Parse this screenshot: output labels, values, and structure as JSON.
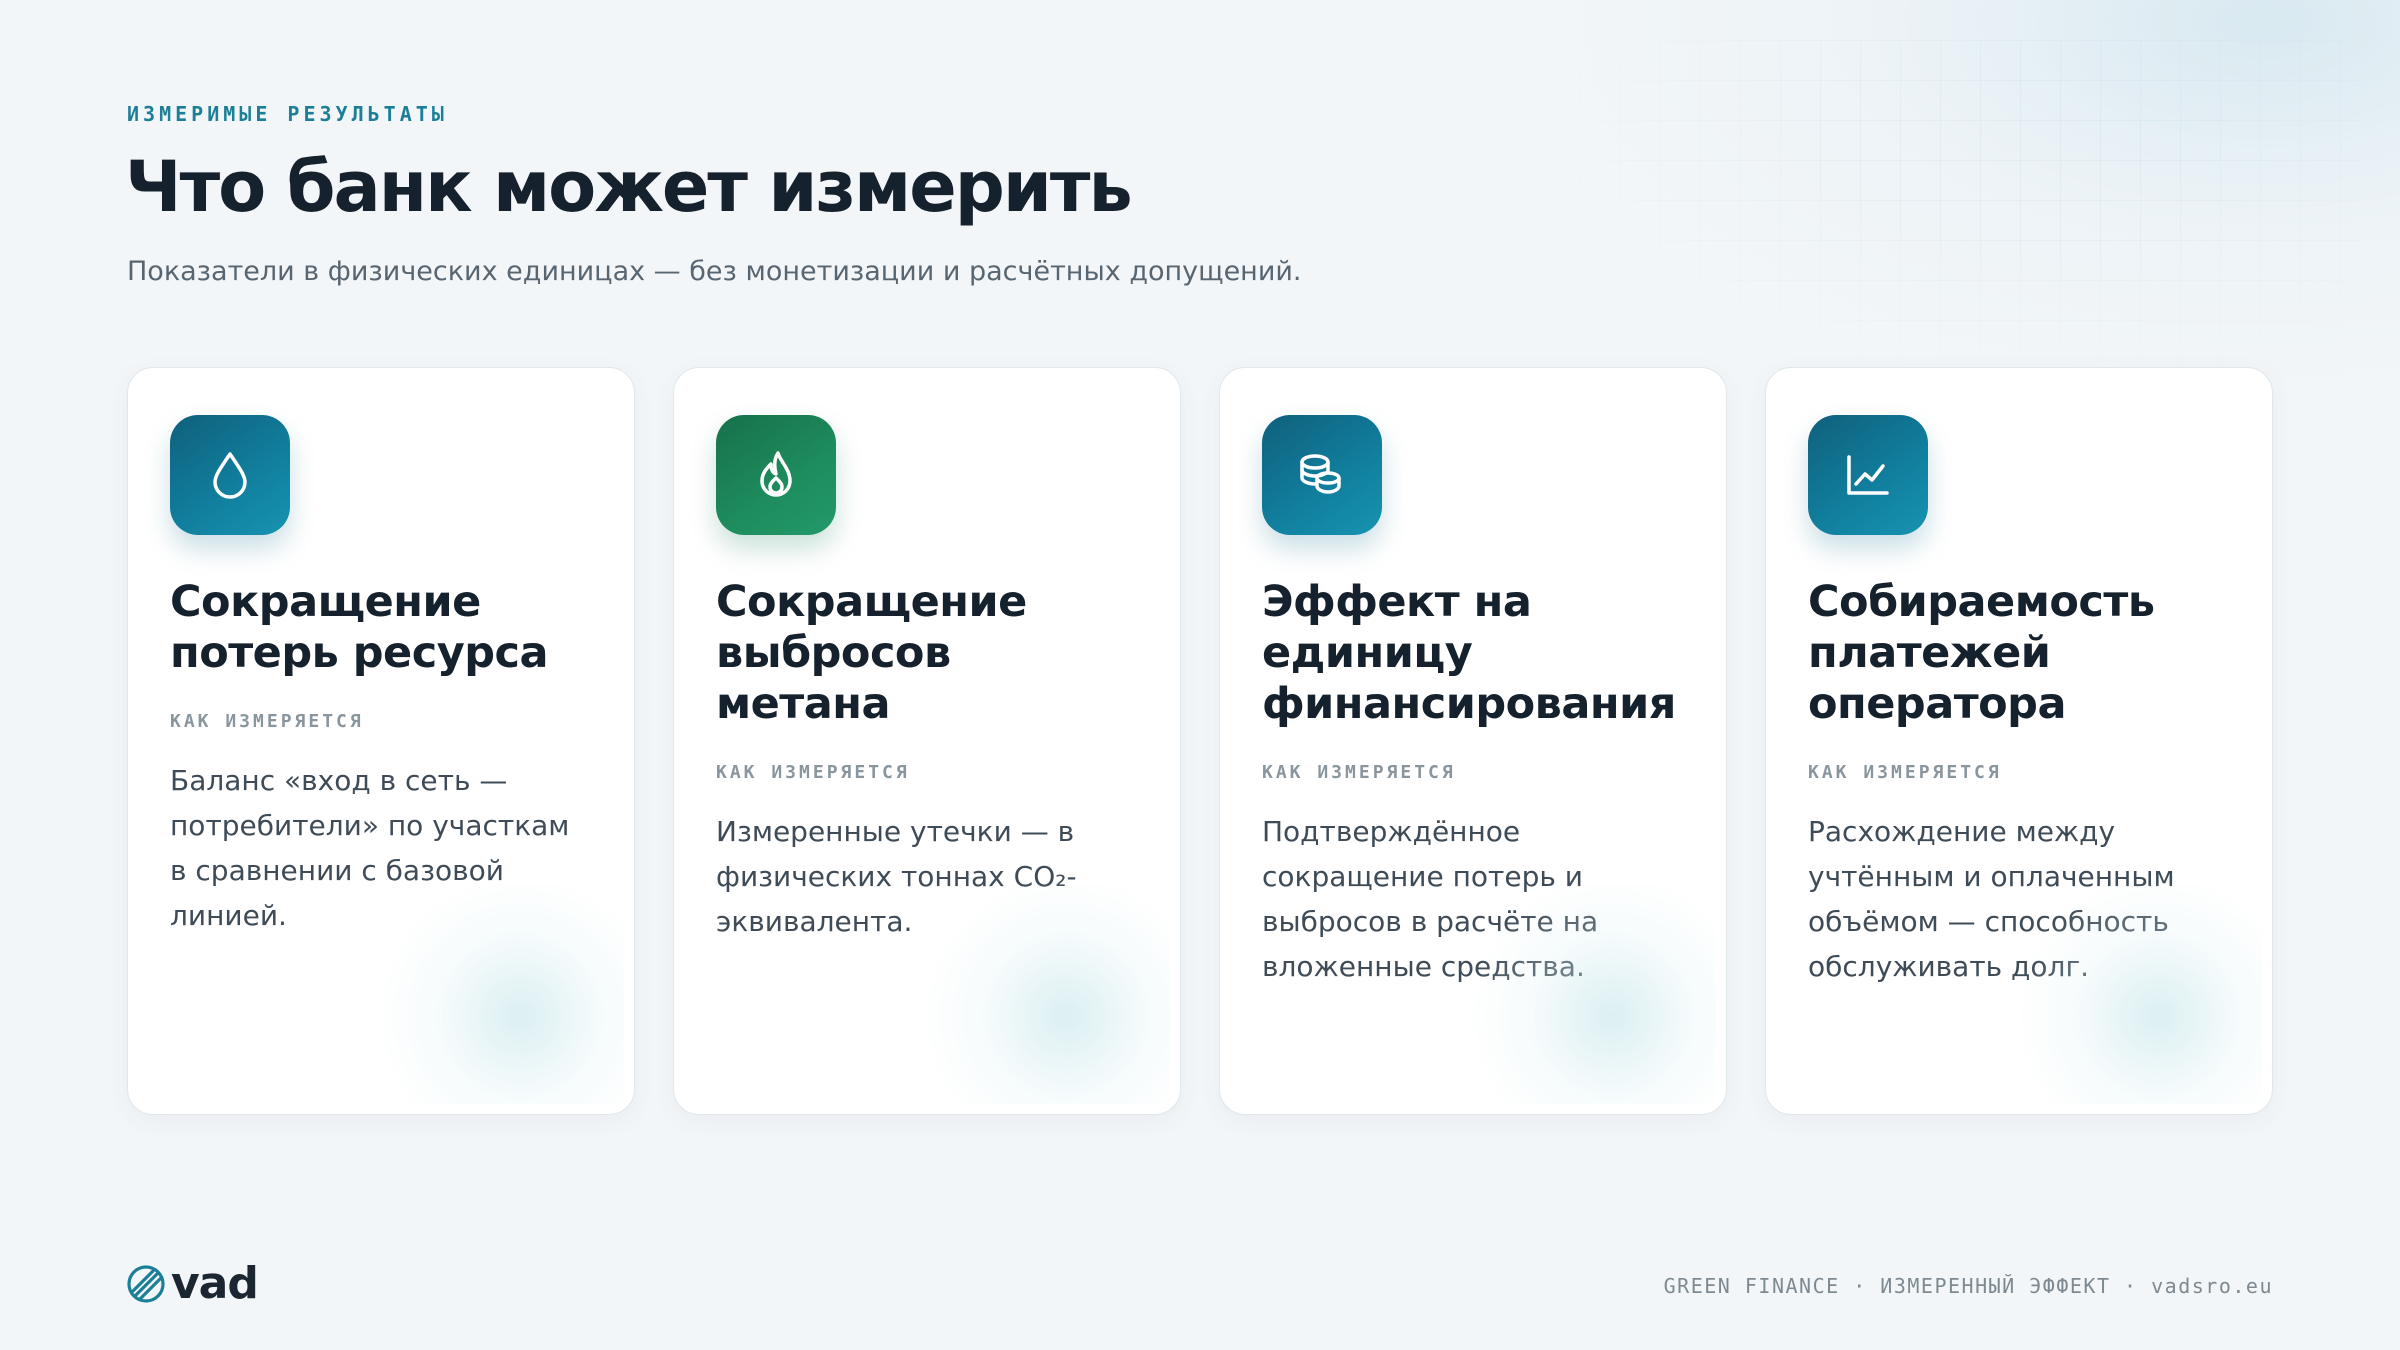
{
  "header": {
    "eyebrow": "ИЗМЕРИМЫЕ РЕЗУЛЬТАТЫ",
    "title": "Что банк может измерить",
    "subtitle": "Показатели в физических единицах — без монетизации и расчётных допущений."
  },
  "cards": [
    {
      "icon": "water-drop-icon",
      "title": "Сокращение потерь ресурса",
      "label": "КАК ИЗМЕРЯЕТСЯ",
      "text": "Баланс «вход в сеть — потребители» по участкам в сравнении с базовой линией."
    },
    {
      "icon": "flame-icon",
      "title": "Сокращение выбросов метана",
      "label": "КАК ИЗМЕРЯЕТСЯ",
      "text": "Измеренные утечки — в физических тоннах CO₂-эквивалента."
    },
    {
      "icon": "coins-icon",
      "title": "Эффект на единицу финансирования",
      "label": "КАК ИЗМЕРЯЕТСЯ",
      "text": "Подтверждённое сокращение потерь и выбросов в расчёте на вложенные средства."
    },
    {
      "icon": "line-chart-icon",
      "title": "Собираемость платежей оператора",
      "label": "КАК ИЗМЕРЯЕТСЯ",
      "text": "Расхождение между учтённым и оплаченным объёмом — способность обслуживать долг."
    }
  ],
  "footer": {
    "logo_text": "vad",
    "tagline": "GREEN FINANCE · ИЗМЕРЕННЫЙ ЭФФЕКТ · vadsro.eu"
  },
  "colors": {
    "accent": "#1b7f97",
    "icon_blue": "#11809f",
    "icon_green": "#1e8d5d",
    "title": "#15212c"
  }
}
